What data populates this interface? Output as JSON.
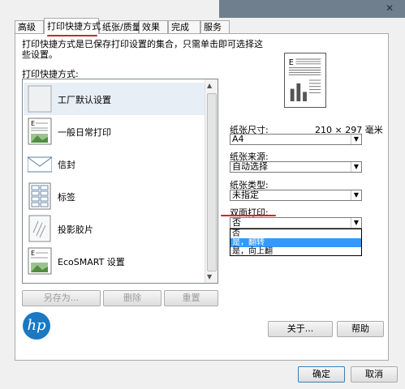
{
  "tabs": [
    "高级",
    "打印快捷方式",
    "纸张/质量",
    "效果",
    "完成",
    "服务"
  ],
  "description": "打印快捷方式是已保存打印设置的集合，只需单击即可选择这些设置。",
  "list_label": "打印快捷方式:",
  "shortcuts": [
    "工厂默认设置",
    "一般日常打印",
    "信封",
    "标签",
    "投影胶片",
    "EcoSMART 设置"
  ],
  "buttons": {
    "save_as": "另存为...",
    "delete": "删除",
    "reset": "重置",
    "about": "关于...",
    "help": "帮助",
    "ok": "确定",
    "cancel": "取消"
  },
  "paper_size": {
    "label": "纸张尺寸:",
    "dims": "210 × 297 毫米",
    "value": "A4"
  },
  "paper_source": {
    "label": "纸张来源:",
    "value": "自动选择"
  },
  "paper_type": {
    "label": "纸张类型:",
    "value": "未指定"
  },
  "duplex": {
    "label": "双面打印:",
    "value": "否",
    "options": [
      "否",
      "是，翻转",
      "是，向上翻"
    ]
  },
  "logo_text": "hp",
  "colors": {
    "accent": "#d0262b",
    "highlight": "#3399ff",
    "hp_blue": "#1b78c2"
  }
}
